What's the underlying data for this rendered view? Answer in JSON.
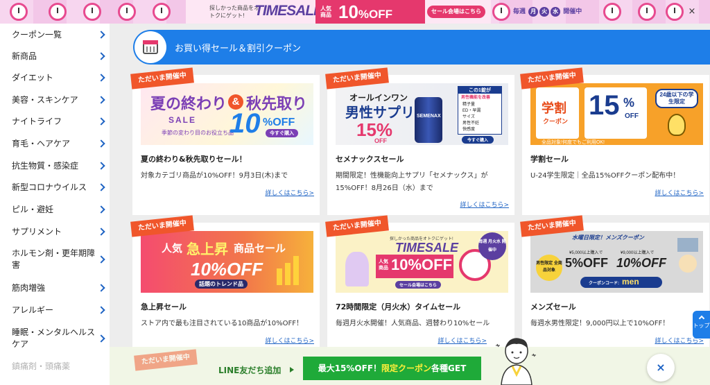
{
  "top_banner": {
    "subtitle": "探しかった商品をオトクにゲット!",
    "title": "TIMESALE",
    "red_prefix": "人気商品",
    "percent": "10",
    "percent_suffix": "%OFF",
    "pill": "セール会場はこちら",
    "week_pre": "毎週",
    "days": [
      "月",
      "火",
      "水"
    ],
    "week_post": "開催中",
    "close": "×"
  },
  "sidebar": {
    "items": [
      {
        "label": "クーポン一覧"
      },
      {
        "label": "新商品"
      },
      {
        "label": "ダイエット"
      },
      {
        "label": "美容・スキンケア"
      },
      {
        "label": "ナイトライフ"
      },
      {
        "label": "育毛・ヘアケア"
      },
      {
        "label": "抗生物質・感染症"
      },
      {
        "label": "新型コロナウイルス"
      },
      {
        "label": "ピル・避妊"
      },
      {
        "label": "サプリメント"
      },
      {
        "label": "ホルモン剤・更年期障害"
      },
      {
        "label": "筋肉増強"
      },
      {
        "label": "アレルギー"
      },
      {
        "label": "睡眠・メンタルヘルスケア"
      },
      {
        "label": "鎮痛剤・頭痛薬"
      }
    ]
  },
  "section": {
    "title": "お買い得セール＆割引クーポン"
  },
  "badge_label": "ただいま開催中",
  "cards": [
    {
      "title": "夏の終わり&秋先取りセール！",
      "desc": "対象カテゴリ商品が10%OFF！9月3日(木)まで",
      "link": "詳しくはこちら>",
      "art": {
        "line1": "夏の終わり",
        "amp": "&",
        "line2": "秋先取り",
        "sale": "SALE",
        "sub": "季節の変わり目のお役立ち品",
        "big": "10",
        "pct": "%OFF",
        "btn": "今すぐ購入"
      }
    },
    {
      "title": "セメナックスセール",
      "desc": "期間限定！性機能向上サプリ「セメナックス」が15%OFF！8月26日（水）まで",
      "link": "詳しくはこちら>",
      "art": {
        "l1": "オールインワン",
        "l2": "男性サプリ",
        "big": "15%",
        "off": "OFF",
        "box_head": "この1錠が",
        "box_sub": "男性機能を改善",
        "checks": [
          "精子量",
          "ED・早漏",
          "サイズ",
          "男性不妊",
          "快感度"
        ],
        "brand": "SEMENAX",
        "btn": "今すぐ購入"
      }
    },
    {
      "title": "学割セール",
      "desc": "U-24学生限定｜全品15%OFFクーポン配布中！",
      "link": "詳しくはこちら>",
      "art": {
        "l1": "学割",
        "l2": "クーポン",
        "big": "15",
        "pct": "%",
        "off": "OFF",
        "badge": "24歳以下の学生限定",
        "foot": "全品対象!何度でもご利用OK!"
      }
    },
    {
      "title": "急上昇セール",
      "desc": "ストア内で最も注目されている10商品が10%OFF！",
      "link": "詳しくはこちら>",
      "art": {
        "l1": "人気",
        "l2": "急上昇",
        "l3": "商品セール",
        "big": "10%OFF",
        "tag": "話題のトレンド品"
      }
    },
    {
      "title": "72時間限定（月火水）タイムセール",
      "desc": "毎週月火水開催！人気商品、週替わり10%セール",
      "link": "詳しくはこちら>",
      "art": {
        "sub": "探しかった商品をオトクにゲット!",
        "title": "TIMESALE",
        "pre": "人気商品",
        "big": "10%OFF",
        "pill": "セール会場はこちら",
        "tag": "毎週 月火水 開催中"
      }
    },
    {
      "title": "メンズセール",
      "desc": "毎週水男性限定！9,000円以上で10%OFF！",
      "link": "詳しくはこちら>",
      "art": {
        "head": "水曜日限定！メンズクーポン",
        "tag": "男性限定 全商品対象",
        "t1": "¥5,000以上購入で",
        "v1": "5%OFF",
        "t2": "¥9,000以上購入で",
        "v2": "10%OFF",
        "code_label": "クーポンコード:",
        "code": "men"
      }
    }
  ],
  "line_banner": {
    "label": "LINE友だち追加",
    "button_pre": "最大15%OFF！",
    "button_hl": "限定クーポン",
    "button_post": "各種GET"
  },
  "close_fab": "×",
  "top_button": "トップ",
  "colors": {
    "primary": "#1e7ee8",
    "badge": "#f0562b",
    "line_green": "#1faa39"
  }
}
